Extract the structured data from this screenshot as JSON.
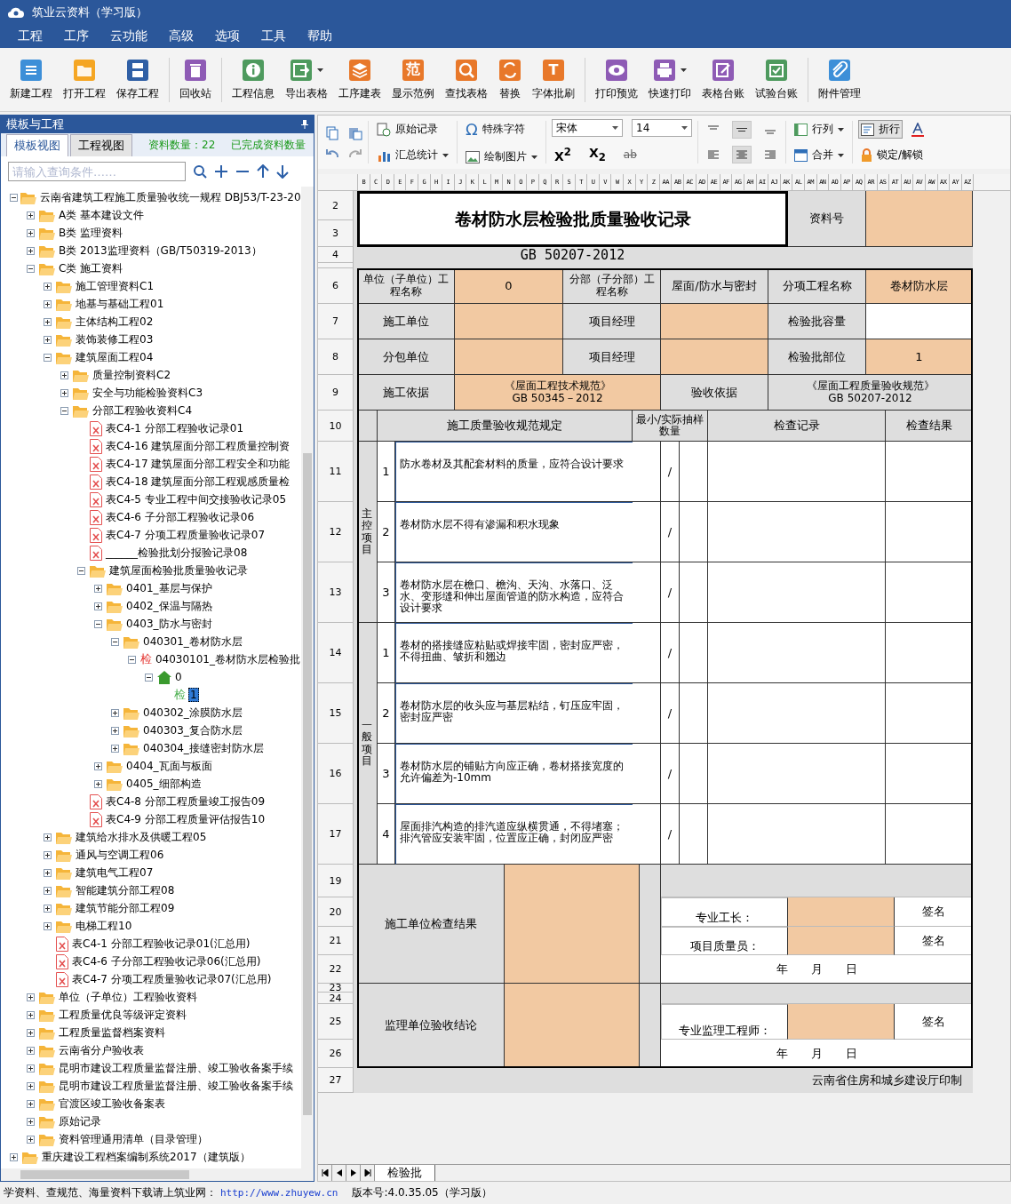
{
  "window": {
    "title": "筑业云资料（学习版）"
  },
  "menu": [
    "工程",
    "工序",
    "云功能",
    "高级",
    "选项",
    "工具",
    "帮助"
  ],
  "ribbon": [
    {
      "label": "新建工程"
    },
    {
      "label": "打开工程"
    },
    {
      "label": "保存工程"
    },
    {
      "label": "回收站"
    },
    {
      "label": "工程信息"
    },
    {
      "label": "导出表格",
      "dropdown": true
    },
    {
      "label": "工序建表"
    },
    {
      "label": "显示范例",
      "glyph": "范"
    },
    {
      "label": "查找表格"
    },
    {
      "label": "替换"
    },
    {
      "label": "字体批刷",
      "glyph": "T"
    },
    {
      "label": "打印预览"
    },
    {
      "label": "快速打印",
      "dropdown": true
    },
    {
      "label": "表格台账"
    },
    {
      "label": "试验台账"
    },
    {
      "label": "附件管理"
    }
  ],
  "left_panel": {
    "title": "模板与工程",
    "tabs": [
      {
        "label": "模板视图",
        "selected": true
      },
      {
        "label": "工程视图",
        "selected": false
      }
    ],
    "count": "资料数量：22",
    "done_count": "已完成资料数量",
    "search": {
      "placeholder": "请输入查询条件……"
    },
    "tree": [
      {
        "label": "云南省建筑工程施工质量验收统一规程 DBJ53/T-23-20",
        "kind": "folder",
        "expanded": true,
        "selected": false,
        "children": [
          {
            "label": "A类 基本建设文件",
            "kind": "folder",
            "expanded": false,
            "selected": false
          },
          {
            "label": "B类 监理资料",
            "kind": "folder",
            "expanded": false,
            "selected": false
          },
          {
            "label": "B类 2013监理资料（GB/T50319-2013）",
            "kind": "folder",
            "expanded": false,
            "selected": false
          },
          {
            "label": "C类 施工资料",
            "kind": "folder",
            "expanded": true,
            "selected": false,
            "children": [
              {
                "label": "施工管理资料C1",
                "kind": "folder",
                "expanded": false,
                "selected": false
              },
              {
                "label": "地基与基础工程01",
                "kind": "folder",
                "expanded": false,
                "selected": false
              },
              {
                "label": "主体结构工程02",
                "kind": "folder",
                "expanded": false,
                "selected": false
              },
              {
                "label": "装饰装修工程03",
                "kind": "folder",
                "expanded": false,
                "selected": false
              },
              {
                "label": "建筑屋面工程04",
                "kind": "folder",
                "expanded": true,
                "selected": false,
                "children": [
                  {
                    "label": "质量控制资料C2",
                    "kind": "folder",
                    "expanded": false,
                    "selected": false
                  },
                  {
                    "label": "安全与功能检验资料C3",
                    "kind": "folder",
                    "expanded": false,
                    "selected": false
                  },
                  {
                    "label": "分部工程验收资料C4",
                    "kind": "folder",
                    "expanded": true,
                    "selected": false,
                    "children": [
                      {
                        "label": "表C4-1 分部工程验收记录01",
                        "kind": "doc",
                        "selected": false
                      },
                      {
                        "label": "表C4-16 建筑屋面分部工程质量控制资",
                        "kind": "doc",
                        "selected": false
                      },
                      {
                        "label": "表C4-17 建筑屋面分部工程安全和功能",
                        "kind": "doc",
                        "selected": false
                      },
                      {
                        "label": "表C4-18 建筑屋面分部工程观感质量检",
                        "kind": "doc",
                        "selected": false
                      },
                      {
                        "label": "表C4-5 专业工程中间交接验收记录05",
                        "kind": "doc",
                        "selected": false
                      },
                      {
                        "label": "表C4-6 子分部工程验收记录06",
                        "kind": "doc",
                        "selected": false
                      },
                      {
                        "label": "表C4-7 分项工程质量验收记录07",
                        "kind": "doc",
                        "selected": false
                      },
                      {
                        "label": "______检验批划分报验记录08",
                        "kind": "doc",
                        "selected": false
                      },
                      {
                        "label": "建筑屋面检验批质量验收记录",
                        "kind": "folder",
                        "expanded": true,
                        "selected": false,
                        "children": [
                          {
                            "label": "0401_基层与保护",
                            "kind": "folder",
                            "expanded": false,
                            "selected": false
                          },
                          {
                            "label": "0402_保温与隔热",
                            "kind": "folder",
                            "expanded": false,
                            "selected": false
                          },
                          {
                            "label": "0403_防水与密封",
                            "kind": "folder",
                            "expanded": true,
                            "selected": false,
                            "children": [
                              {
                                "label": "040301_卷材防水层",
                                "kind": "folder",
                                "expanded": true,
                                "selected": false,
                                "children": [
                                  {
                                    "label": "04030101_卷材防水层检验批",
                                    "kind": "check",
                                    "badge": "检",
                                    "color": "#e53935",
                                    "expanded": true,
                                    "selected": false,
                                    "children": [
                                      {
                                        "label": "0",
                                        "kind": "home",
                                        "expanded": true,
                                        "selected": false,
                                        "children": [
                                          {
                                            "label": "1",
                                            "kind": "check",
                                            "badge": "检",
                                            "color": "#4caf50",
                                            "selected": true
                                          }
                                        ]
                                      }
                                    ]
                                  }
                                ]
                              },
                              {
                                "label": "040302_涂膜防水层",
                                "kind": "folder",
                                "expanded": false,
                                "selected": false
                              },
                              {
                                "label": "040303_复合防水层",
                                "kind": "folder",
                                "expanded": false,
                                "selected": false
                              },
                              {
                                "label": "040304_接缝密封防水层",
                                "kind": "folder",
                                "expanded": false,
                                "selected": false
                              }
                            ]
                          },
                          {
                            "label": "0404_瓦面与板面",
                            "kind": "folder",
                            "expanded": false,
                            "selected": false
                          },
                          {
                            "label": "0405_细部构造",
                            "kind": "folder",
                            "expanded": false,
                            "selected": false
                          }
                        ]
                      },
                      {
                        "label": "表C4-8 分部工程质量竣工报告09",
                        "kind": "doc",
                        "selected": false
                      },
                      {
                        "label": "表C4-9 分部工程质量评估报告10",
                        "kind": "doc",
                        "selected": false
                      }
                    ]
                  }
                ]
              },
              {
                "label": "建筑给水排水及供暖工程05",
                "kind": "folder",
                "expanded": false,
                "selected": false
              },
              {
                "label": "通风与空调工程06",
                "kind": "folder",
                "expanded": false,
                "selected": false
              },
              {
                "label": "建筑电气工程07",
                "kind": "folder",
                "expanded": false,
                "selected": false
              },
              {
                "label": "智能建筑分部工程08",
                "kind": "folder",
                "expanded": false,
                "selected": false
              },
              {
                "label": "建筑节能分部工程09",
                "kind": "folder",
                "expanded": false,
                "selected": false
              },
              {
                "label": "电梯工程10",
                "kind": "folder",
                "expanded": false,
                "selected": false
              },
              {
                "label": "表C4-1 分部工程验收记录01(汇总用)",
                "kind": "doc",
                "selected": false
              },
              {
                "label": "表C4-6 子分部工程验收记录06(汇总用)",
                "kind": "doc",
                "selected": false
              },
              {
                "label": "表C4-7 分项工程质量验收记录07(汇总用)",
                "kind": "doc",
                "selected": false
              }
            ]
          },
          {
            "label": "单位（子单位）工程验收资料",
            "kind": "folder",
            "expanded": false,
            "selected": false
          },
          {
            "label": "工程质量优良等级评定资料",
            "kind": "folder",
            "expanded": false,
            "selected": false
          },
          {
            "label": "工程质量监督档案资料",
            "kind": "folder",
            "expanded": false,
            "selected": false
          },
          {
            "label": "云南省分户验收表",
            "kind": "folder",
            "expanded": false,
            "selected": false
          },
          {
            "label": "昆明市建设工程质量监督注册、竣工验收备案手续",
            "kind": "folder",
            "expanded": false,
            "selected": false
          },
          {
            "label": "昆明市建设工程质量监督注册、竣工验收备案手续",
            "kind": "folder",
            "expanded": false,
            "selected": false
          },
          {
            "label": "官渡区竣工验收备案表",
            "kind": "folder",
            "expanded": false,
            "selected": false
          },
          {
            "label": "原始记录",
            "kind": "folder",
            "expanded": false,
            "selected": false
          },
          {
            "label": "资料管理通用清单（目录管理）",
            "kind": "folder",
            "expanded": false,
            "selected": false
          }
        ]
      },
      {
        "label": "重庆建设工程档案编制系统2017（建筑版）",
        "kind": "folder",
        "expanded": false,
        "selected": false
      }
    ]
  },
  "format_bar": {
    "original_record": "原始记录",
    "summary": "汇总统计",
    "special_char_glyph": "Ω",
    "special_char": "特殊字符",
    "draw_picture": "绘制图片",
    "font": "宋体",
    "size": "14",
    "superscript": "X$^{2}$",
    "subscript": "X$_{2}$",
    "strike": "ab",
    "vertical_align": [
      {
        "selected": false
      },
      {
        "selected": true
      },
      {
        "selected": false
      }
    ],
    "horizontal_align": [
      {
        "selected": false
      },
      {
        "selected": true
      },
      {
        "selected": false
      }
    ],
    "rows_cols": "行列",
    "merge": "合并",
    "wrap": {
      "label": "折行",
      "on": true
    },
    "lock": "锁定/解锁"
  },
  "sheet": {
    "columns": [
      "B",
      "C",
      "D",
      "E",
      "F",
      "G",
      "H",
      "I",
      "J",
      "K",
      "L",
      "M",
      "N",
      "O",
      "P",
      "Q",
      "R",
      "S",
      "T",
      "U",
      "V",
      "W",
      "X",
      "Y",
      "Z",
      "AA",
      "AB",
      "AC",
      "AD",
      "AE",
      "AF",
      "AG",
      "AH",
      "AI",
      "AJ",
      "AK",
      "AL",
      "AM",
      "AN",
      "AO",
      "AP",
      "AQ",
      "AR",
      "AS",
      "AT",
      "AU",
      "AV",
      "AW",
      "AX",
      "AY",
      "AZ"
    ],
    "row_numbers": [
      "2",
      "3",
      "4",
      "6",
      "7",
      "8",
      "9",
      "10",
      "11",
      "12",
      "13",
      "14",
      "15",
      "16",
      "17",
      "19",
      "20",
      "21",
      "22",
      "23",
      "24",
      "25",
      "26",
      "27"
    ],
    "tabs": [
      {
        "label": "检验批",
        "selected": true
      }
    ]
  },
  "form": {
    "title": "卷材防水层检验批质量验收记录",
    "doc_no_label": "资料号",
    "standard": "GB 50207-2012",
    "unit_project_label": "单位（子单位）工程名称",
    "unit_project": "0",
    "sub_project_label": "分部（子分部）工程名称",
    "sub_project": "屋面/防水与密封",
    "item_project_label": "分项工程名称",
    "item_project": "卷材防水层",
    "contractor_label": "施工单位",
    "manager_label": "项目经理",
    "capacity_label": "检验批容量",
    "subcontractor_label": "分包单位",
    "manager_label_2": "项目经理",
    "location_label": "检验批部位",
    "location": "1",
    "basis_label": "施工依据",
    "basis": [
      "《屋面工程技术规范》",
      "GB 50345－2012"
    ],
    "acceptance_label": "验收依据",
    "acceptance": [
      "《屋面工程质量验收规范》",
      "GB 50207-2012"
    ],
    "spec_header": "施工质量验收规范规定",
    "sample_header": "最小/实际抽样数量",
    "record_header": "检查记录",
    "result_header": "检查结果",
    "sections": [
      {
        "label": "主控项目",
        "items": [
          {
            "no": "1",
            "text": "防水卷材及其配套材料的质量，应符合设计要求",
            "sample": "/"
          },
          {
            "no": "2",
            "text": "卷材防水层不得有渗漏和积水现象",
            "sample": "/"
          },
          {
            "no": "3",
            "text": "卷材防水层在檐口、檐沟、天沟、水落口、泛水、变形缝和伸出屋面管道的防水构造，应符合设计要求",
            "sample": "/"
          }
        ]
      },
      {
        "label": "一般项目",
        "items": [
          {
            "no": "1",
            "text": "卷材的搭接缝应粘贴或焊接牢固，密封应严密，不得扭曲、皱折和翘边",
            "sample": "/"
          },
          {
            "no": "2",
            "text": "卷材防水层的收头应与基层粘结，钉压应牢固，密封应严密",
            "sample": "/"
          },
          {
            "no": "3",
            "text": "卷材防水层的铺贴方向应正确，卷材搭接宽度的允许偏差为-10mm",
            "sample": "/"
          },
          {
            "no": "4",
            "text": "屋面排汽构造的排汽道应纵横贯通，不得堵塞；排汽管应安装牢固，位置应正确，封闭应严密",
            "sample": "/"
          }
        ]
      }
    ],
    "contractor_result_label": "施工单位检查结果",
    "foreman_label": "专业工长：",
    "sign_1": "签名",
    "qc_label": "项目质量员：",
    "sign_2": "签名",
    "date_1": "年　　月　　日",
    "supervisor_label": "监理单位验收结论",
    "engineer_label": "专业监理工程师：",
    "sign_3": "签名",
    "date_2": "年　　月　　日",
    "printer": "云南省住房和城乡建设厅印制"
  },
  "status_bar": {
    "promo": "学资料、查规范、海量资料下载请上筑业网：",
    "link": "http://www.zhuyew.cn",
    "version": "版本号:4.0.35.05（学习版）"
  }
}
